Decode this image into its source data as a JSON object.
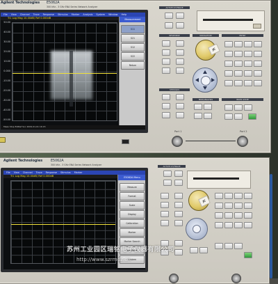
{
  "top_unit": {
    "brand": "Agilent Technologies",
    "model": "E5062A",
    "description": "300 kHz - 3 GHz ENA Series Network Analyzer",
    "menubar": [
      "File",
      "View",
      "Channel",
      "Trace",
      "Response",
      "Stimulus",
      "Marker",
      "Analysis",
      "System",
      "Window",
      "Help"
    ],
    "trace_header": "Tr1 Log Mag 10.00dB/ Ref 0.000dB",
    "y_ticks": [
      "50.00",
      "40.00",
      "30.00",
      "20.00",
      "10.00",
      "0.000",
      "-10.00",
      "-20.00",
      "-30.00",
      "-40.00",
      "-50.00"
    ],
    "softmenu_title": "Measurement",
    "softkeys": [
      "S11",
      "S21",
      "S12",
      "S22",
      "Return"
    ],
    "status": "Meas  Stop  ExtRef  Svc  2009-01-01 16:15"
  },
  "bottom_unit": {
    "brand": "Agilent Technologies",
    "model": "E5062A",
    "description": "300 kHz - 3 GHz ENA Series Network Analyzer",
    "menubar": [
      "File",
      "View",
      "Channel",
      "Trace",
      "Response",
      "Stimulus",
      "Marker"
    ],
    "trace_header": "Tr1 Log Mag 10.00dB/ Ref 0.000dB",
    "softmenu_title": "E5062A Menu",
    "softkeys": [
      "Measure",
      "Format",
      "Scale",
      "Display",
      "Calibration",
      "Marker",
      "Marker Search",
      "Save/Recall",
      "System"
    ],
    "status": "Meas  Stop  ExtRef  Svc"
  },
  "section_labels": {
    "active": "ACTIVE CH/TRACE",
    "response": "RESPONSE",
    "navigation": "NAVIGATION",
    "entry": "ENTRY",
    "stimulus": "STIMULUS",
    "mkr": "MKR/ANALYSIS",
    "instr": "INSTR STATE"
  },
  "port_labels": {
    "port1": "Port 1",
    "port2": "Port 2"
  },
  "knob_sticker": "JC",
  "watermark": {
    "line1": "苏州工业园区瑞铭电子仪器有限公司",
    "line2": "http://www.szrmdz.cn"
  }
}
